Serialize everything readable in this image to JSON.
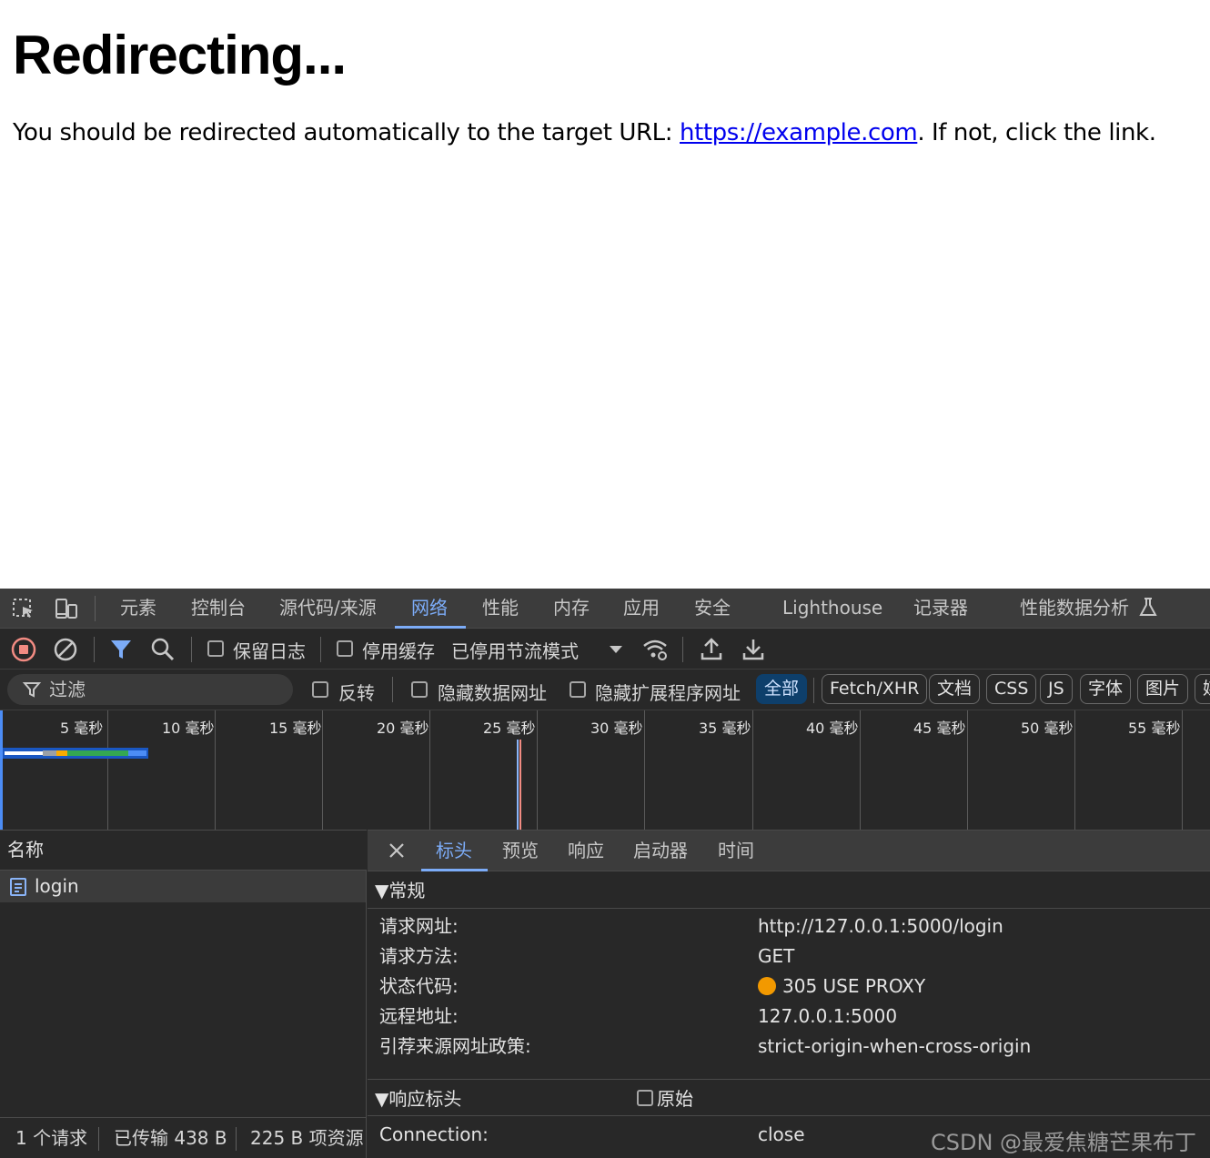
{
  "page": {
    "title": "Redirecting...",
    "text_before_link": "You should be redirected automatically to the target URL: ",
    "link_text": "https://example.com",
    "text_after_link": ". If not, click the link."
  },
  "devtools": {
    "tabs": [
      "元素",
      "控制台",
      "源代码/来源",
      "网络",
      "性能",
      "内存",
      "应用",
      "安全",
      "Lighthouse",
      "记录器",
      "性能数据分析"
    ],
    "active_tab": "网络",
    "toolbar": {
      "preserve_log": "保留日志",
      "disable_cache": "停用缓存",
      "throttling": "已停用节流模式"
    },
    "filter": {
      "placeholder": "过滤",
      "invert": "反转",
      "hide_data_urls": "隐藏数据网址",
      "hide_extension_urls": "隐藏扩展程序网址",
      "types": [
        "全部",
        "Fetch/XHR",
        "文档",
        "CSS",
        "JS",
        "字体",
        "图片",
        "媒"
      ],
      "active_type": "全部"
    },
    "timeline_ticks": [
      "5 毫秒",
      "10 毫秒",
      "15 毫秒",
      "20 毫秒",
      "25 毫秒",
      "30 毫秒",
      "35 毫秒",
      "40 毫秒",
      "45 毫秒",
      "50 毫秒",
      "55 毫秒"
    ],
    "request_list": {
      "header": "名称",
      "rows": [
        {
          "name": "login"
        }
      ]
    },
    "statusbar": {
      "requests": "1 个请求",
      "transferred": "已传输 438 B",
      "resources": "225 B 项资源"
    },
    "detail": {
      "tabs": [
        "标头",
        "预览",
        "响应",
        "启动器",
        "时间"
      ],
      "active_tab": "标头",
      "general_title": "▼常规",
      "general": [
        {
          "key": "请求网址:",
          "value": "http://127.0.0.1:5000/login"
        },
        {
          "key": "请求方法:",
          "value": "GET"
        },
        {
          "key": "状态代码:",
          "value": "305 USE PROXY"
        },
        {
          "key": "远程地址:",
          "value": "127.0.0.1:5000"
        },
        {
          "key": "引荐来源网址政策:",
          "value": "strict-origin-when-cross-origin"
        }
      ],
      "status_color": "#f29900",
      "response_headers_title": "▼响应标头",
      "raw_label": "原始",
      "response_headers": [
        {
          "key": "Connection:",
          "value": "close"
        }
      ]
    }
  },
  "watermark": "CSDN @最爱焦糖芒果布丁"
}
